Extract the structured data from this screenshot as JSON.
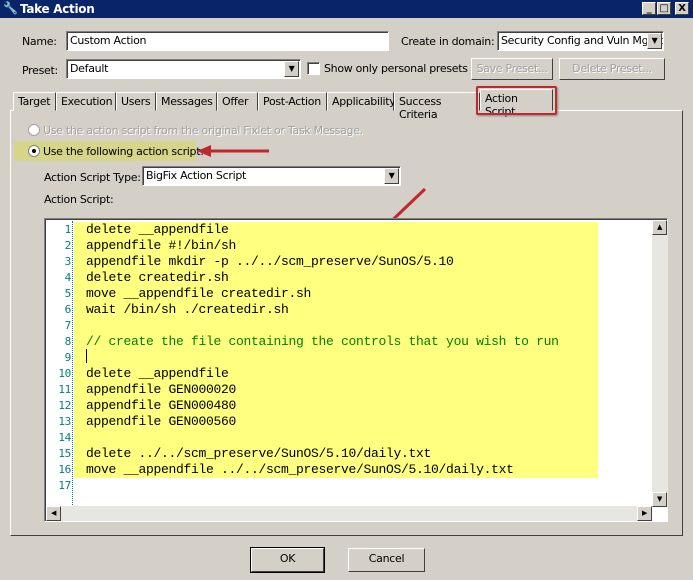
{
  "window": {
    "title": "Take Action",
    "minimize": "_",
    "maximize": "□",
    "close": "X"
  },
  "form": {
    "name_label": "Name:",
    "name_value": "Custom Action",
    "domain_label": "Create in domain:",
    "domain_value": "Security Config and Vuln Mgmt",
    "preset_label": "Preset:",
    "preset_value": "Default",
    "personal_presets_label": "Show only personal presets",
    "save_preset": "Save Preset...",
    "delete_preset": "Delete Preset..."
  },
  "tabs": [
    "Target",
    "Execution",
    "Users",
    "Messages",
    "Offer",
    "Post-Action",
    "Applicability",
    "Success Criteria",
    "Action Script"
  ],
  "action_script": {
    "option_original": "Use the action script from the original Fixlet or Task Message.",
    "option_following": "Use the following action script:",
    "type_label": "Action Script Type:",
    "type_value": "BigFix Action Script",
    "script_label": "Action Script:"
  },
  "code_lines": [
    "delete __appendfile",
    "appendfile #!/bin/sh",
    "appendfile mkdir -p ../../scm_preserve/SunOS/5.10",
    "delete createdir.sh",
    "move __appendfile createdir.sh",
    "wait /bin/sh ./createdir.sh",
    "",
    "// create the file containing the controls that you wish to run",
    "",
    "delete __appendfile",
    "appendfile GEN000020",
    "appendfile GEN000480",
    "appendfile GEN000560",
    "",
    "delete ../../scm_preserve/SunOS/5.10/daily.txt",
    "move __appendfile ../../scm_preserve/SunOS/5.10/daily.txt",
    ""
  ],
  "line_numbers": [
    "1",
    "2",
    "3",
    "4",
    "5",
    "6",
    "7",
    "8",
    "9",
    "10",
    "11",
    "12",
    "13",
    "14",
    "15",
    "16",
    "17"
  ],
  "buttons": {
    "ok": "OK",
    "cancel": "Cancel"
  }
}
